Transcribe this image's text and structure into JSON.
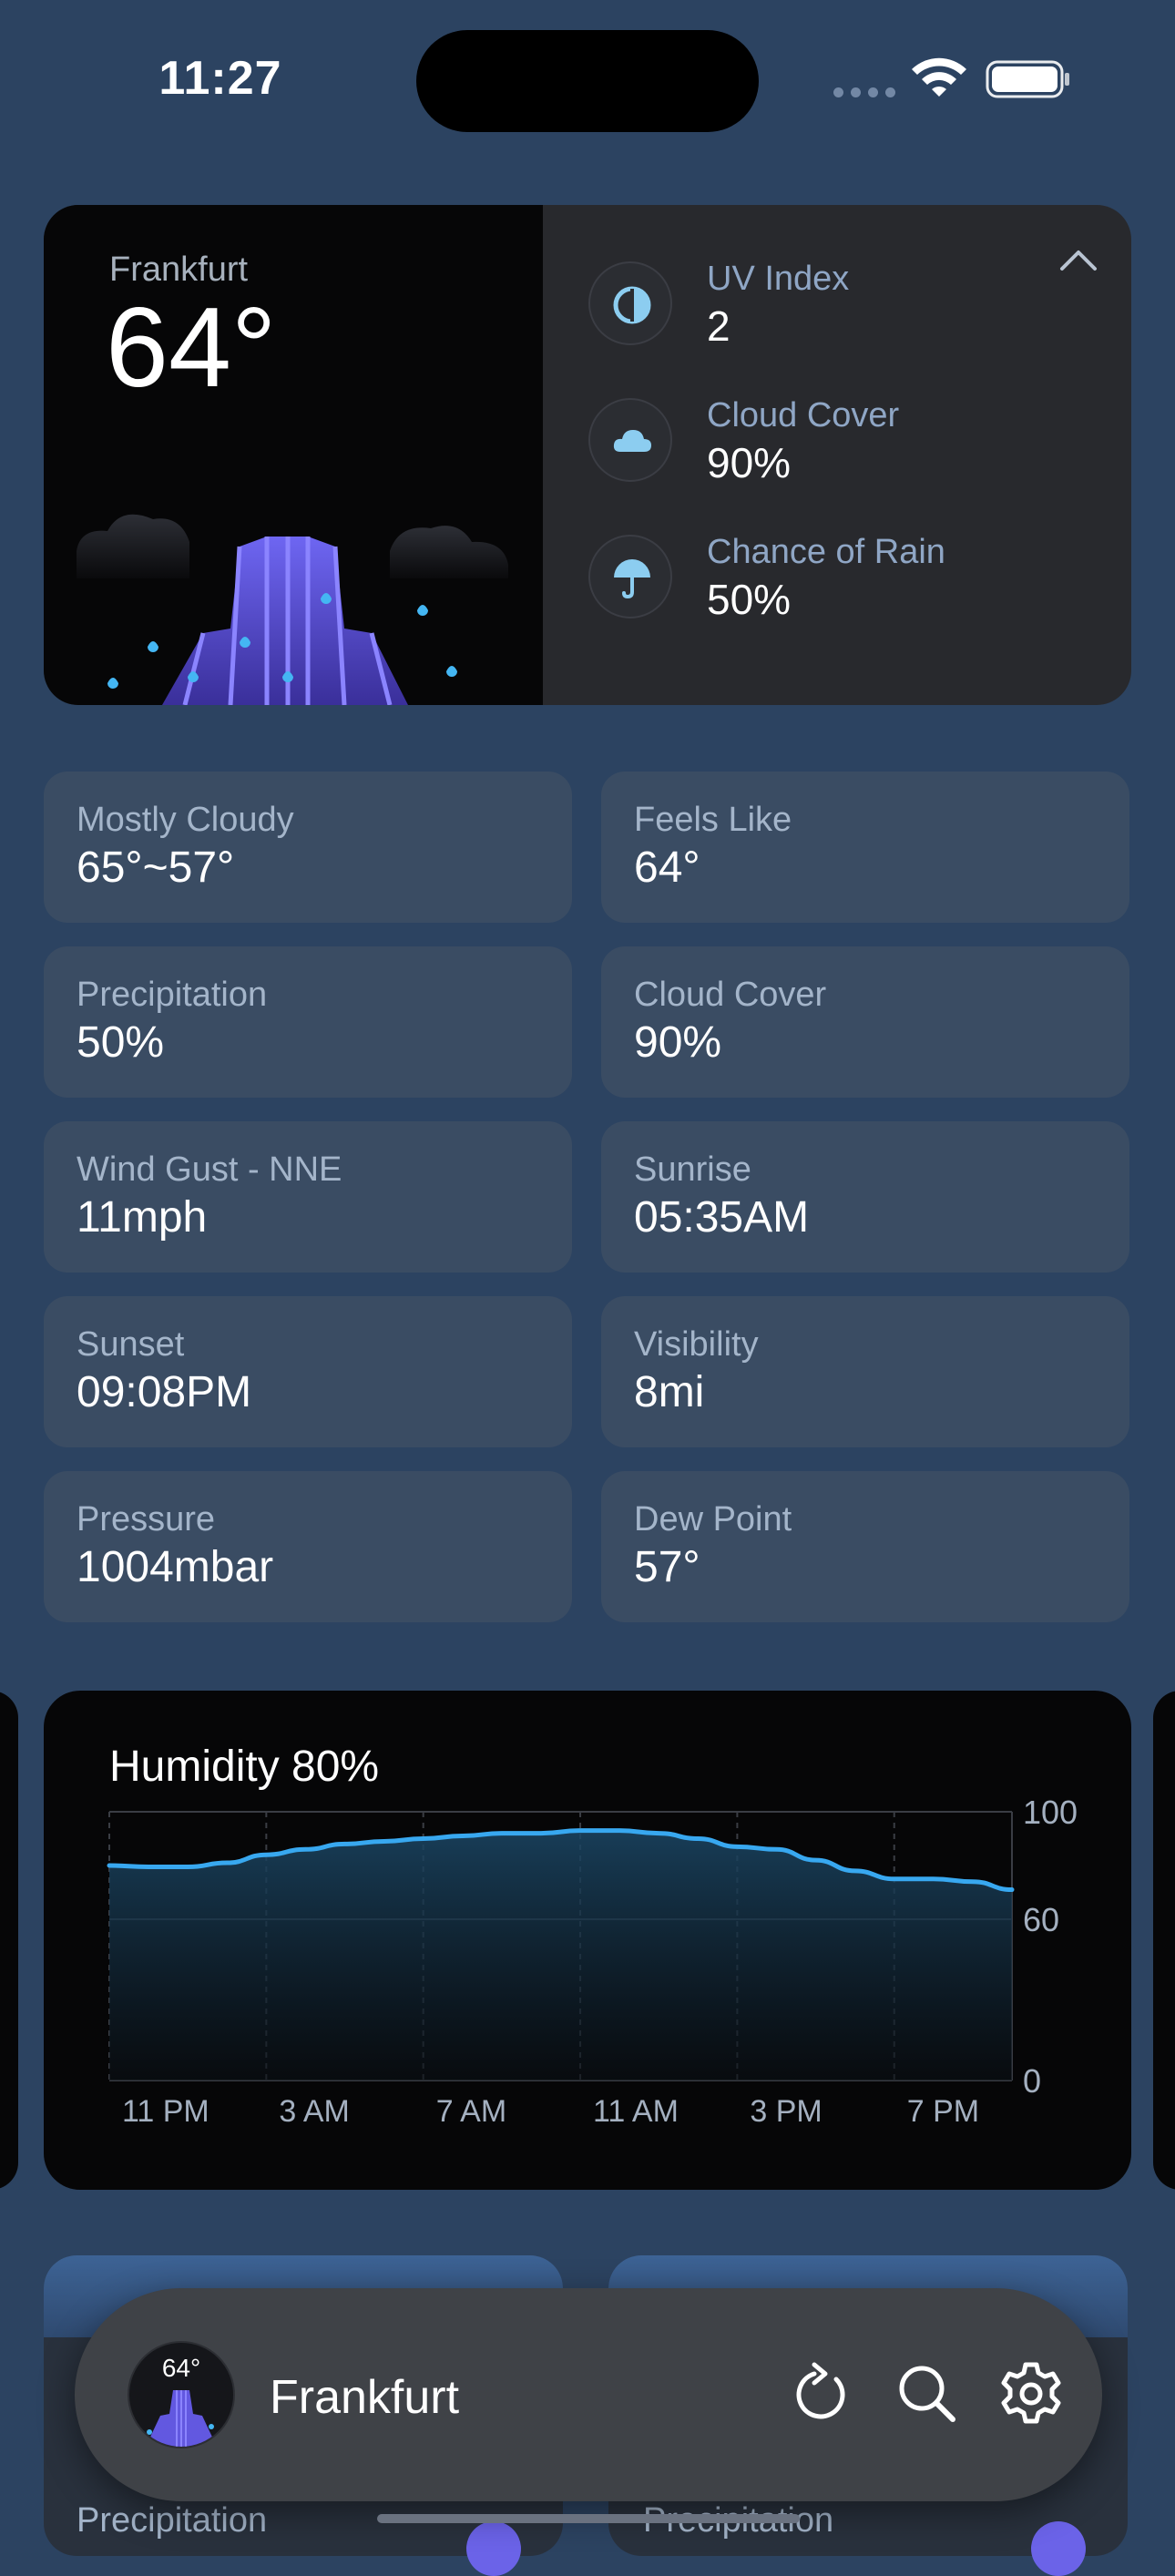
{
  "status_bar": {
    "time": "11:27"
  },
  "current": {
    "city": "Frankfurt",
    "temperature": "64°",
    "details": [
      {
        "label": "UV Index",
        "value": "2",
        "icon": "uv-index-icon"
      },
      {
        "label": "Cloud Cover",
        "value": "90%",
        "icon": "cloud-icon"
      },
      {
        "label": "Chance of Rain",
        "value": "50%",
        "icon": "umbrella-icon"
      }
    ]
  },
  "tiles": [
    {
      "label": "Mostly Cloudy",
      "value": "65°~57°"
    },
    {
      "label": "Feels Like",
      "value": "64°"
    },
    {
      "label": "Precipitation",
      "value": "50%"
    },
    {
      "label": "Cloud Cover",
      "value": "90%"
    },
    {
      "label": "Wind Gust - NNE",
      "value": "11mph"
    },
    {
      "label": "Sunrise",
      "value": "05:35AM"
    },
    {
      "label": "Sunset",
      "value": "09:08PM"
    },
    {
      "label": "Visibility",
      "value": "8mi"
    },
    {
      "label": "Pressure",
      "value": "1004mbar"
    },
    {
      "label": "Dew Point",
      "value": "57°"
    }
  ],
  "humidity": {
    "title": "Humidity 80%",
    "chart_data": {
      "type": "area",
      "title": "Humidity 80%",
      "x_tick_labels": [
        "11 PM",
        "3 AM",
        "7 AM",
        "11 AM",
        "3 PM",
        "7 PM"
      ],
      "y_tick_labels": [
        "100",
        "60",
        "0"
      ],
      "ylim": [
        0,
        100
      ],
      "x": [
        "11 PM",
        "12 AM",
        "1 AM",
        "2 AM",
        "3 AM",
        "4 AM",
        "5 AM",
        "6 AM",
        "7 AM",
        "8 AM",
        "9 AM",
        "10 AM",
        "11 AM",
        "12 PM",
        "1 PM",
        "2 PM",
        "3 PM",
        "4 PM",
        "5 PM",
        "6 PM",
        "7 PM",
        "8 PM",
        "9 PM",
        "10 PM"
      ],
      "series": [
        {
          "values": [
            80,
            79.5,
            79.5,
            81,
            84,
            86,
            88,
            89,
            90,
            91,
            92,
            92,
            93,
            93,
            92,
            90,
            87,
            86,
            82,
            78,
            75,
            75,
            74,
            71
          ]
        }
      ],
      "grid": true,
      "color": "#38a8f0"
    }
  },
  "bottom_cards": [
    {
      "label": "Precipitation"
    },
    {
      "label": "Precipitation"
    }
  ],
  "bottom_bar": {
    "city": "Frankfurt",
    "temperature": "64°"
  }
}
